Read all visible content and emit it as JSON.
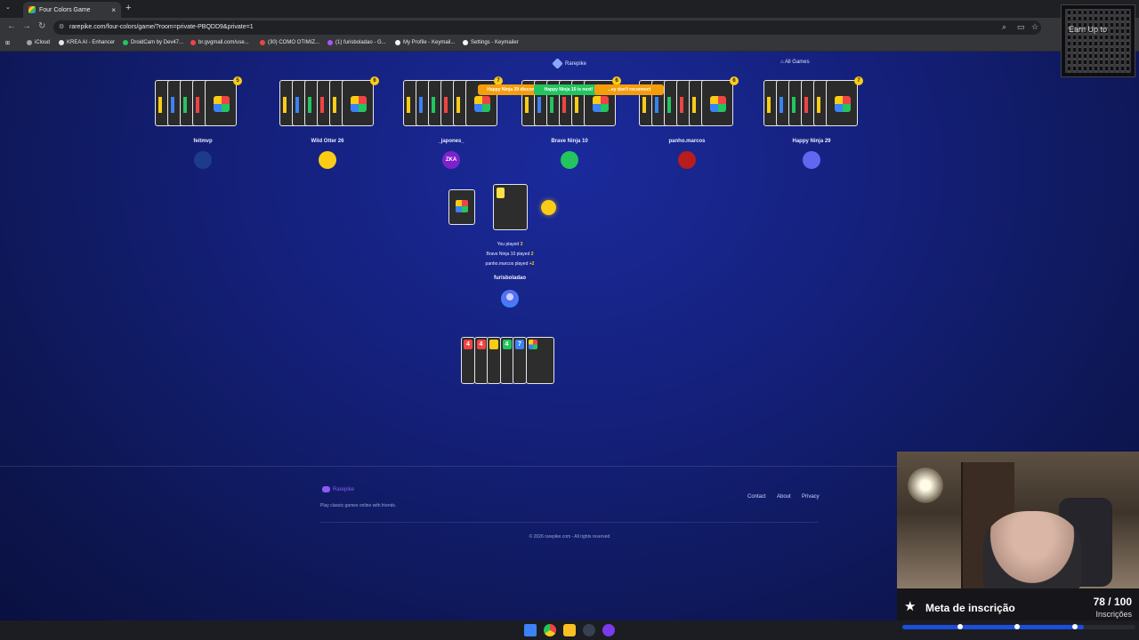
{
  "browser": {
    "tab_title": "Four Colors Game",
    "new_tab": "+",
    "tab_close": "×",
    "url": "rarepike.com/four-colors/game/?room=private-PBQDD9&private=1",
    "bookmarks": [
      {
        "label": "iCloud",
        "color": "#9ca3af"
      },
      {
        "label": "KREA AI - Enhancer",
        "color": "#e5e7eb"
      },
      {
        "label": "DroidCam by Dev47...",
        "color": "#22c55e"
      },
      {
        "label": "br.gvgmall.com/use...",
        "color": "#ef4444"
      },
      {
        "label": "(30) COMO OTIMIZ...",
        "color": "#ef4444"
      },
      {
        "label": "(1) furisboladao - G...",
        "color": "#a855f7"
      },
      {
        "label": "My Profile - Keymail...",
        "color": "#f5f5f5"
      },
      {
        "label": "Settings - Keymailer",
        "color": "#f5f5f5"
      }
    ]
  },
  "site": {
    "brand": "Rarepike",
    "all_games": "All Games"
  },
  "players": [
    {
      "name": "feitmvp",
      "cards": 5,
      "avatar_color": "#1e3a8a",
      "top_color": "four"
    },
    {
      "name": "Wild Otter 26",
      "cards": 6,
      "avatar_color": "#facc15",
      "top_color": "four"
    },
    {
      "name": "_japones_",
      "cards": 7,
      "avatar_color": "#7e22ce",
      "avatar_text": "ZKA",
      "top_color": "four"
    },
    {
      "name": "Brave Ninja 10",
      "cards": 6,
      "avatar_color": "#22c55e",
      "top_color": "four"
    },
    {
      "name": "panho.marcos",
      "cards": 6,
      "avatar_color": "#b91c1c",
      "top_color": "four"
    },
    {
      "name": "Happy Ninja 29",
      "cards": 7,
      "avatar_color": "#6366f1",
      "top_color": "four"
    }
  ],
  "toasts": [
    {
      "text": "Happy Ninja 29 discon...",
      "color": "#f59e0b"
    },
    {
      "text": "Happy Ninja 10 is next!",
      "color": "#22c55e"
    },
    {
      "text": "...ey don't reconnect",
      "color": "#f59e0b"
    }
  ],
  "table": {
    "current_color": "#facc15",
    "log": [
      {
        "prefix": "You played ",
        "value": "3"
      },
      {
        "prefix": "Brave Ninja 10 played ",
        "value": "2"
      },
      {
        "prefix": "panho.marcos played ",
        "value": "+2"
      }
    ]
  },
  "me": {
    "name": "furisboladao",
    "hand": [
      {
        "label": "4",
        "color": "#ef4444"
      },
      {
        "label": "4",
        "color": "#ef4444"
      },
      {
        "label": "",
        "color": "#facc15"
      },
      {
        "label": "4",
        "color": "#22c55e"
      },
      {
        "label": "7",
        "color": "#3b82f6"
      },
      {
        "label": "",
        "color": "four"
      }
    ]
  },
  "footer": {
    "brand": "Rarepike",
    "tagline": "Play classic games online with friends.",
    "links": [
      "Contact",
      "About",
      "Privacy"
    ],
    "copyright": "© 2026 rarepike.com - All rights reserved"
  },
  "overlay": {
    "qr_text": "Earn Up to",
    "goal_title": "Meta de inscrição",
    "goal_count": "78 / 100",
    "goal_label": "Inscrições",
    "goal_progress": 0.78
  }
}
